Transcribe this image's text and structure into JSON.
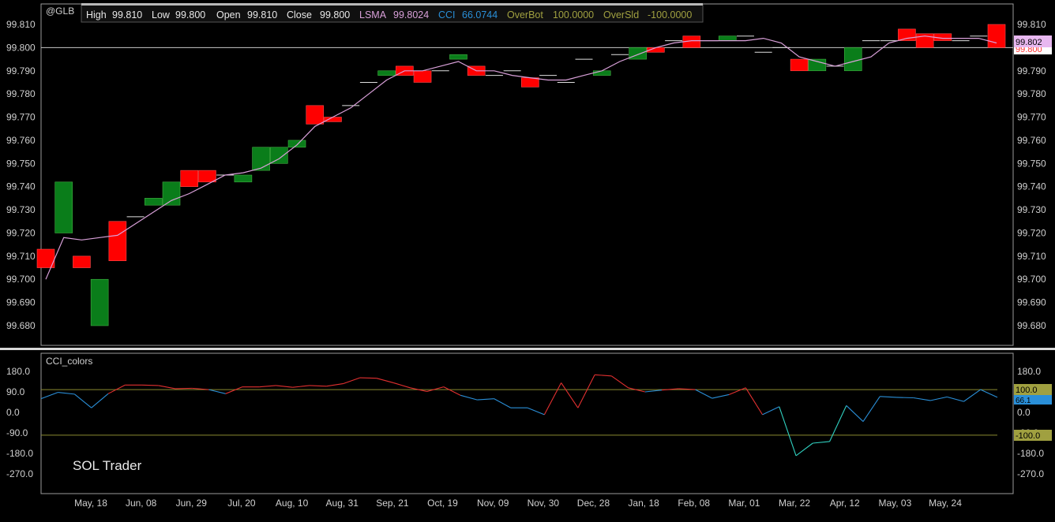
{
  "symbol": "@GLB",
  "info_bar": {
    "high_label": "High",
    "high_value": "99.810",
    "low_label": "Low",
    "low_value": "99.800",
    "open_label": "Open",
    "open_value": "99.810",
    "close_label": "Close",
    "close_value": "99.800",
    "lsma_label": "LSMA",
    "lsma_value": "99.8024",
    "cci_label": "CCI",
    "cci_value": "66.0744",
    "overbot_label": "OverBot",
    "overbot_value": "100.0000",
    "oversld_label": "OverSld",
    "oversld_value": "-100.0000"
  },
  "price_badges": {
    "last_close": "99.800",
    "lsma": "99.802"
  },
  "indicator_title": "CCI_colors",
  "indicator_badges": {
    "overbot": "100.0",
    "cci": "66.1",
    "oversld": "-100.0"
  },
  "watermark": "SOL Trader",
  "colors": {
    "background": "#000000",
    "up": "#0a7d1a",
    "down": "#ff0000",
    "lsma": "#d9a0d9",
    "cci_normal": "#2a8fd8",
    "cci_high": "#e23030",
    "cci_low": "#30d0c0",
    "level_lines": "#8a8a30",
    "grid_frame": "#9a9a9a"
  },
  "chart_data": {
    "type": "candlestick",
    "price_axis": {
      "ticks": [
        "99.810",
        "99.800",
        "99.790",
        "99.780",
        "99.770",
        "99.760",
        "99.750",
        "99.740",
        "99.730",
        "99.720",
        "99.710",
        "99.700",
        "99.690",
        "99.680"
      ]
    },
    "cci_axis": {
      "ticks": [
        "180.0",
        "90.0",
        "0.0",
        "-90.0",
        "-180.0",
        "-270.0"
      ],
      "overbot": 100,
      "oversld": -100
    },
    "x_axis_labels": [
      "May, 18",
      "Jun, 08",
      "Jun, 29",
      "Jul, 20",
      "Aug, 10",
      "Aug, 31",
      "Sep, 21",
      "Oct, 19",
      "Nov, 09",
      "Nov, 30",
      "Dec, 28",
      "Jan, 18",
      "Feb, 08",
      "Mar, 01",
      "Mar, 22",
      "Apr, 12",
      "May, 03",
      "May, 24"
    ],
    "reference_price": 99.8,
    "ohlc": [
      [
        99.713,
        99.705
      ],
      [
        99.72,
        99.742
      ],
      [
        99.71,
        99.705
      ],
      [
        99.68,
        99.7
      ],
      [
        99.725,
        99.708
      ],
      [
        99.727,
        99.727
      ],
      [
        99.732,
        99.735
      ],
      [
        99.732,
        99.742
      ],
      [
        99.747,
        99.74
      ],
      [
        99.747,
        99.742
      ],
      [
        99.745,
        99.745
      ],
      [
        99.742,
        99.745
      ],
      [
        99.747,
        99.757
      ],
      [
        99.75,
        99.757
      ],
      [
        99.757,
        99.76
      ],
      [
        99.775,
        99.767
      ],
      [
        99.77,
        99.768
      ],
      [
        99.775,
        99.775
      ],
      [
        99.785,
        99.785
      ],
      [
        99.788,
        99.79
      ],
      [
        99.792,
        99.788
      ],
      [
        99.79,
        99.785
      ],
      [
        99.79,
        99.79
      ],
      [
        99.795,
        99.797
      ],
      [
        99.792,
        99.788
      ],
      [
        99.788,
        99.788
      ],
      [
        99.79,
        99.79
      ],
      [
        99.787,
        99.783
      ],
      [
        99.788,
        99.788
      ],
      [
        99.785,
        99.785
      ],
      [
        99.795,
        99.795
      ],
      [
        99.788,
        99.79
      ],
      [
        99.797,
        99.797
      ],
      [
        99.795,
        99.8
      ],
      [
        99.8,
        99.798
      ],
      [
        99.803,
        99.803
      ],
      [
        99.805,
        99.8
      ],
      [
        99.803,
        99.803
      ],
      [
        99.803,
        99.805
      ],
      [
        99.805,
        99.805
      ],
      [
        99.798,
        99.798
      ],
      [
        99.8,
        99.8
      ],
      [
        99.795,
        99.79
      ],
      [
        99.79,
        99.795
      ],
      [
        99.792,
        99.792
      ],
      [
        99.79,
        99.8
      ],
      [
        99.803,
        99.803
      ],
      [
        99.803,
        99.803
      ],
      [
        99.808,
        99.803
      ],
      [
        99.806,
        99.8
      ],
      [
        99.806,
        99.803
      ],
      [
        99.803,
        99.803
      ],
      [
        99.805,
        99.805
      ],
      [
        99.81,
        99.8
      ]
    ],
    "lsma": [
      99.7,
      99.718,
      99.717,
      99.718,
      99.719,
      99.724,
      99.729,
      99.734,
      99.737,
      99.741,
      99.745,
      99.746,
      99.748,
      99.752,
      99.758,
      99.766,
      99.77,
      99.774,
      99.78,
      99.786,
      99.79,
      99.79,
      99.792,
      99.794,
      99.79,
      99.79,
      99.788,
      99.787,
      99.786,
      99.786,
      99.788,
      99.79,
      99.794,
      99.797,
      99.8,
      99.802,
      99.803,
      99.803,
      99.803,
      99.803,
      99.804,
      99.802,
      99.796,
      99.794,
      99.792,
      99.794,
      99.796,
      99.802,
      99.804,
      99.805,
      99.804,
      99.804,
      99.804,
      99.802
    ],
    "cci": [
      60,
      88,
      80,
      20,
      82,
      120,
      120,
      118,
      104,
      106,
      100,
      82,
      112,
      112,
      118,
      110,
      118,
      115,
      126,
      152,
      150,
      130,
      108,
      92,
      112,
      75,
      55,
      60,
      20,
      20,
      -10,
      130,
      20,
      165,
      160,
      108,
      90,
      98,
      104,
      100,
      62,
      78,
      108,
      -10,
      25,
      -190,
      -135,
      -128,
      30,
      -40,
      70,
      66,
      64,
      52,
      68,
      48,
      100,
      66
    ]
  }
}
